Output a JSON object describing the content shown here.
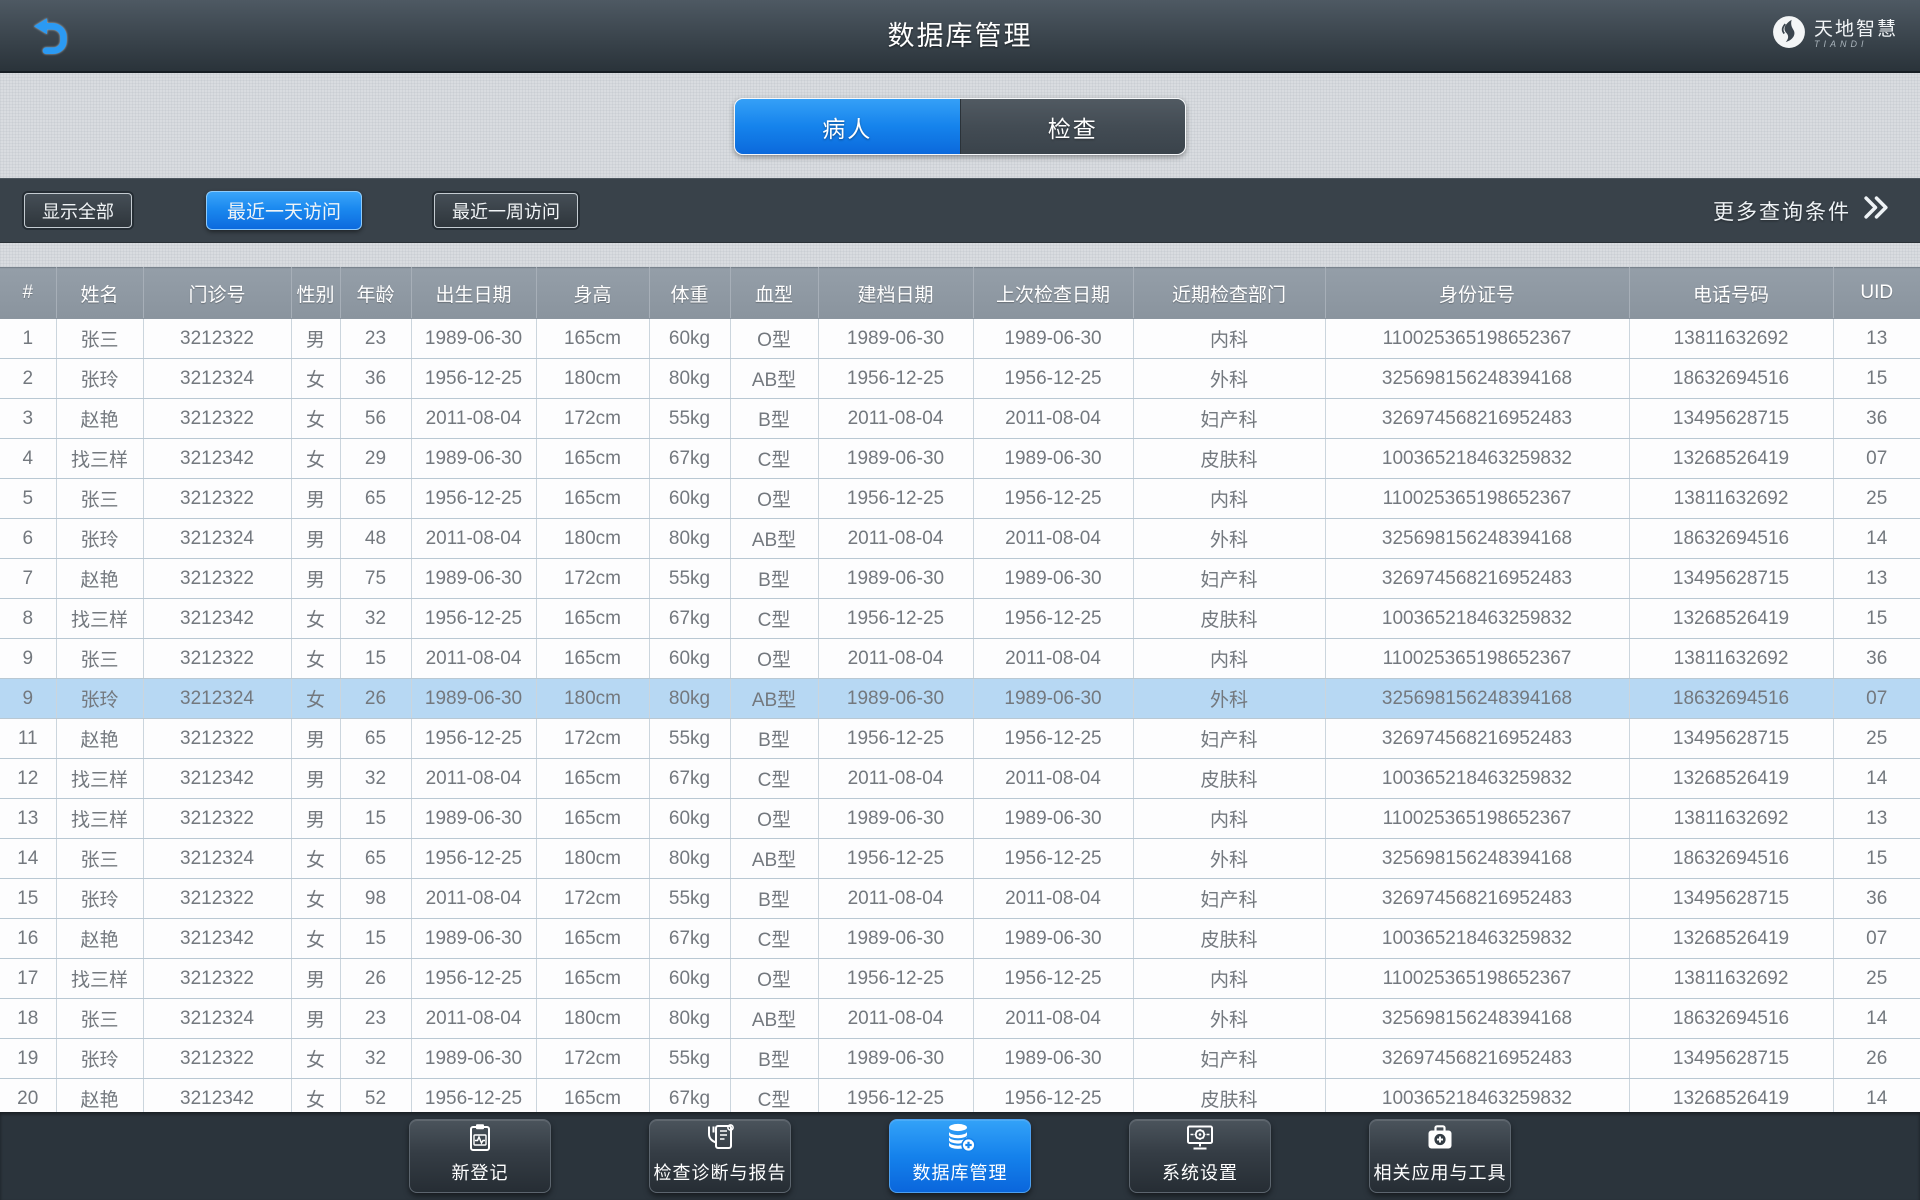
{
  "header": {
    "title": "数据库管理",
    "logo_text": "天地智慧",
    "logo_subtext": "TIANDI"
  },
  "tabs": [
    {
      "label": "病人",
      "active": true
    },
    {
      "label": "检查",
      "active": false
    }
  ],
  "filter_bar": {
    "buttons": [
      {
        "label": "显示全部",
        "active": false
      },
      {
        "label": "最近一天访问",
        "active": true
      },
      {
        "label": "最近一周访问",
        "active": false
      }
    ],
    "more_label": "更多查询条件"
  },
  "table": {
    "columns": [
      "#",
      "姓名",
      "门诊号",
      "性别",
      "年龄",
      "出生日期",
      "身高",
      "体重",
      "血型",
      "建档日期",
      "上次检查日期",
      "近期检查部门",
      "身份证号",
      "电话号码",
      "UID"
    ],
    "selected_row_index": 9,
    "rows": [
      [
        "1",
        "张三",
        "3212322",
        "男",
        "23",
        "1989-06-30",
        "165cm",
        "60kg",
        "O型",
        "1989-06-30",
        "1989-06-30",
        "内科",
        "110025365198652367",
        "13811632692",
        "13"
      ],
      [
        "2",
        "张玲",
        "3212324",
        "女",
        "36",
        "1956-12-25",
        "180cm",
        "80kg",
        "AB型",
        "1956-12-25",
        "1956-12-25",
        "外科",
        "325698156248394168",
        "18632694516",
        "15"
      ],
      [
        "3",
        "赵艳",
        "3212322",
        "女",
        "56",
        "2011-08-04",
        "172cm",
        "55kg",
        "B型",
        "2011-08-04",
        "2011-08-04",
        "妇产科",
        "326974568216952483",
        "13495628715",
        "36"
      ],
      [
        "4",
        "找三样",
        "3212342",
        "女",
        "29",
        "1989-06-30",
        "165cm",
        "67kg",
        "C型",
        "1989-06-30",
        "1989-06-30",
        "皮肤科",
        "100365218463259832",
        "13268526419",
        "07"
      ],
      [
        "5",
        "张三",
        "3212322",
        "男",
        "65",
        "1956-12-25",
        "165cm",
        "60kg",
        "O型",
        "1956-12-25",
        "1956-12-25",
        "内科",
        "110025365198652367",
        "13811632692",
        "25"
      ],
      [
        "6",
        "张玲",
        "3212324",
        "男",
        "48",
        "2011-08-04",
        "180cm",
        "80kg",
        "AB型",
        "2011-08-04",
        "2011-08-04",
        "外科",
        "325698156248394168",
        "18632694516",
        "14"
      ],
      [
        "7",
        "赵艳",
        "3212322",
        "男",
        "75",
        "1989-06-30",
        "172cm",
        "55kg",
        "B型",
        "1989-06-30",
        "1989-06-30",
        "妇产科",
        "326974568216952483",
        "13495628715",
        "13"
      ],
      [
        "8",
        "找三样",
        "3212342",
        "女",
        "32",
        "1956-12-25",
        "165cm",
        "67kg",
        "C型",
        "1956-12-25",
        "1956-12-25",
        "皮肤科",
        "100365218463259832",
        "13268526419",
        "15"
      ],
      [
        "9",
        "张三",
        "3212322",
        "女",
        "15",
        "2011-08-04",
        "165cm",
        "60kg",
        "O型",
        "2011-08-04",
        "2011-08-04",
        "内科",
        "110025365198652367",
        "13811632692",
        "36"
      ],
      [
        "9",
        "张玲",
        "3212324",
        "女",
        "26",
        "1989-06-30",
        "180cm",
        "80kg",
        "AB型",
        "1989-06-30",
        "1989-06-30",
        "外科",
        "325698156248394168",
        "18632694516",
        "07"
      ],
      [
        "11",
        "赵艳",
        "3212322",
        "男",
        "65",
        "1956-12-25",
        "172cm",
        "55kg",
        "B型",
        "1956-12-25",
        "1956-12-25",
        "妇产科",
        "326974568216952483",
        "13495628715",
        "25"
      ],
      [
        "12",
        "找三样",
        "3212342",
        "男",
        "32",
        "2011-08-04",
        "165cm",
        "67kg",
        "C型",
        "2011-08-04",
        "2011-08-04",
        "皮肤科",
        "100365218463259832",
        "13268526419",
        "14"
      ],
      [
        "13",
        "找三样",
        "3212322",
        "男",
        "15",
        "1989-06-30",
        "165cm",
        "60kg",
        "O型",
        "1989-06-30",
        "1989-06-30",
        "内科",
        "110025365198652367",
        "13811632692",
        "13"
      ],
      [
        "14",
        "张三",
        "3212324",
        "女",
        "65",
        "1956-12-25",
        "180cm",
        "80kg",
        "AB型",
        "1956-12-25",
        "1956-12-25",
        "外科",
        "325698156248394168",
        "18632694516",
        "15"
      ],
      [
        "15",
        "张玲",
        "3212322",
        "女",
        "98",
        "2011-08-04",
        "172cm",
        "55kg",
        "B型",
        "2011-08-04",
        "2011-08-04",
        "妇产科",
        "326974568216952483",
        "13495628715",
        "36"
      ],
      [
        "16",
        "赵艳",
        "3212342",
        "女",
        "15",
        "1989-06-30",
        "165cm",
        "67kg",
        "C型",
        "1989-06-30",
        "1989-06-30",
        "皮肤科",
        "100365218463259832",
        "13268526419",
        "07"
      ],
      [
        "17",
        "找三样",
        "3212322",
        "男",
        "26",
        "1956-12-25",
        "165cm",
        "60kg",
        "O型",
        "1956-12-25",
        "1956-12-25",
        "内科",
        "110025365198652367",
        "13811632692",
        "25"
      ],
      [
        "18",
        "张三",
        "3212324",
        "男",
        "23",
        "2011-08-04",
        "180cm",
        "80kg",
        "AB型",
        "2011-08-04",
        "2011-08-04",
        "外科",
        "325698156248394168",
        "18632694516",
        "14"
      ],
      [
        "19",
        "张玲",
        "3212322",
        "女",
        "32",
        "1989-06-30",
        "172cm",
        "55kg",
        "B型",
        "1989-06-30",
        "1989-06-30",
        "妇产科",
        "326974568216952483",
        "13495628715",
        "26"
      ],
      [
        "20",
        "赵艳",
        "3212342",
        "女",
        "52",
        "1956-12-25",
        "165cm",
        "67kg",
        "C型",
        "1956-12-25",
        "1956-12-25",
        "皮肤科",
        "100365218463259832",
        "13268526419",
        "14"
      ]
    ]
  },
  "bottom_nav": {
    "items": [
      {
        "label": "新登记",
        "icon": "clipboard-ecg-icon",
        "active": false
      },
      {
        "label": "检查诊断与报告",
        "icon": "stethoscope-report-icon",
        "active": false
      },
      {
        "label": "数据库管理",
        "icon": "database-plus-icon",
        "active": true
      },
      {
        "label": "系统设置",
        "icon": "monitor-gear-icon",
        "active": false
      },
      {
        "label": "相关应用与工具",
        "icon": "medical-bag-icon",
        "active": false
      }
    ]
  },
  "colors": {
    "accent_blue": "#1180ea",
    "selected_row_blue": "#b7d8f3",
    "topbar_dark": "#333d45",
    "table_header_gray": "#8d97a1"
  }
}
